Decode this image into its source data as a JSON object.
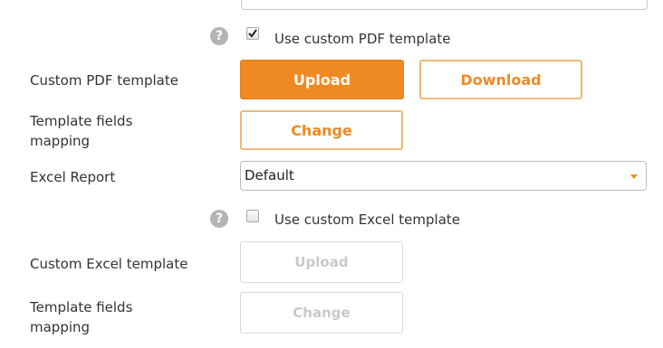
{
  "pdf": {
    "use_custom_template_label": "Use custom PDF template",
    "use_custom_template_checked": true,
    "custom_template_label": "Custom PDF template",
    "upload_label": "Upload",
    "download_label": "Download",
    "fields_mapping_label_line1": "Template fields",
    "fields_mapping_label_line2": "mapping",
    "change_label": "Change"
  },
  "excel": {
    "report_label": "Excel Report",
    "report_value": "Default",
    "use_custom_template_label": "Use custom Excel template",
    "use_custom_template_checked": false,
    "custom_template_label": "Custom Excel template",
    "upload_label": "Upload",
    "fields_mapping_label_line1": "Template fields",
    "fields_mapping_label_line2": "mapping",
    "change_label": "Change"
  },
  "icons": {
    "help_glyph": "?",
    "help_icon": "question-circle",
    "check_icon": "checkmark",
    "dropdown_icon": "caret-down"
  },
  "colors": {
    "accent": "#ef8a23",
    "accent_border": "#f0b878",
    "disabled_text": "#c9c9c9",
    "help_icon_bg": "#b4b4b4"
  }
}
